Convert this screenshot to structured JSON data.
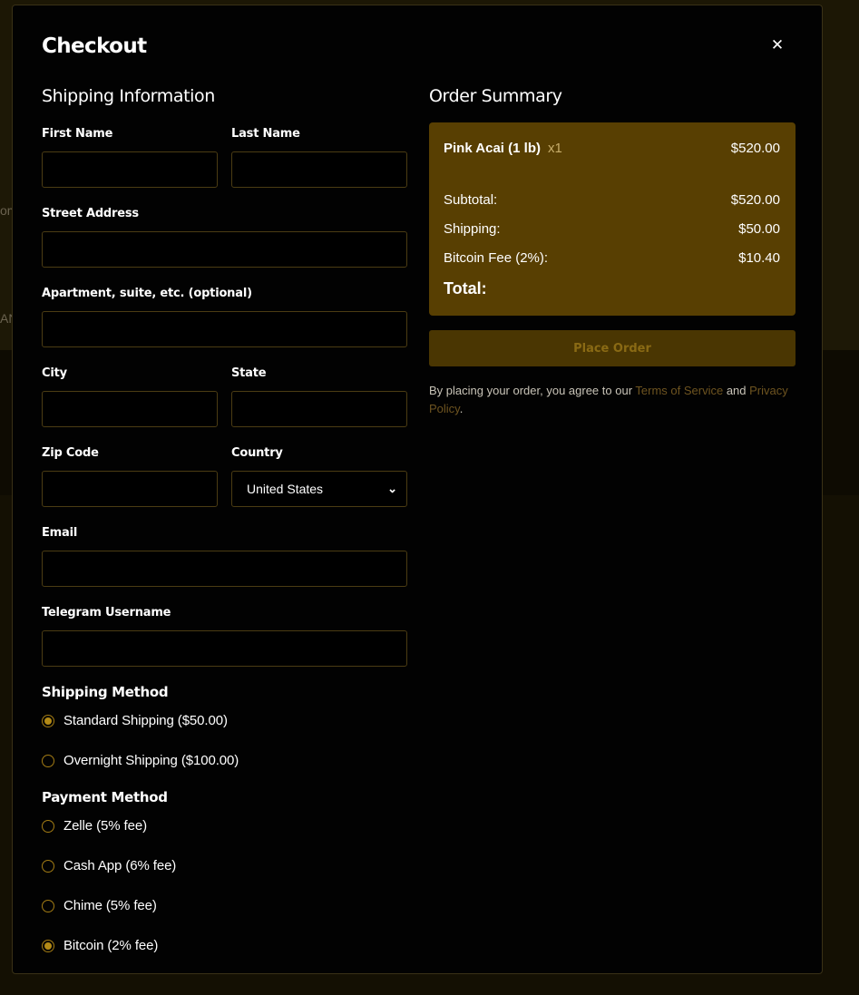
{
  "background": {
    "fragment_1": "om",
    "fragment_2": "AN"
  },
  "modal": {
    "title": "Checkout",
    "close_icon": "close-icon"
  },
  "shipping_info": {
    "heading": "Shipping Information",
    "first_name": {
      "label": "First Name",
      "value": ""
    },
    "last_name": {
      "label": "Last Name",
      "value": ""
    },
    "street": {
      "label": "Street Address",
      "value": ""
    },
    "apartment": {
      "label": "Apartment, suite, etc. (optional)",
      "value": ""
    },
    "city": {
      "label": "City",
      "value": ""
    },
    "state": {
      "label": "State",
      "value": ""
    },
    "zip": {
      "label": "Zip Code",
      "value": ""
    },
    "country": {
      "label": "Country",
      "selected": "United States"
    },
    "email": {
      "label": "Email",
      "value": ""
    },
    "telegram": {
      "label": "Telegram Username",
      "value": ""
    }
  },
  "shipping_method": {
    "heading": "Shipping Method",
    "options": [
      {
        "label": "Standard Shipping ($50.00)",
        "selected": true
      },
      {
        "label": "Overnight Shipping ($100.00)",
        "selected": false
      }
    ]
  },
  "payment_method": {
    "heading": "Payment Method",
    "options": [
      {
        "label": "Zelle (5% fee)",
        "selected": false
      },
      {
        "label": "Cash App (6% fee)",
        "selected": false
      },
      {
        "label": "Chime (5% fee)",
        "selected": false
      },
      {
        "label": "Bitcoin (2% fee)",
        "selected": true
      }
    ]
  },
  "order_summary": {
    "heading": "Order Summary",
    "item": {
      "name": "Pink Acai (1 lb)",
      "qty": "x1",
      "price": "$520.00"
    },
    "subtotal": {
      "label": "Subtotal:",
      "value": "$520.00"
    },
    "shipping": {
      "label": "Shipping:",
      "value": "$50.00"
    },
    "fee": {
      "label": "Bitcoin Fee (2%):",
      "value": "$10.40"
    },
    "total": {
      "label": "Total:",
      "value": ""
    }
  },
  "place_order_label": "Place Order",
  "terms": {
    "prefix": "By placing your order, you agree to our ",
    "tos_link": "Terms of Service",
    "middle": " and ",
    "privacy_link": "Privacy Policy",
    "suffix": "."
  },
  "colors": {
    "accent": "#b38a16",
    "summary_bg": "#583f02",
    "button_bg": "#4a3602",
    "input_border": "#4b3c13",
    "modal_bg": "#020202",
    "page_bg": "#141003"
  }
}
